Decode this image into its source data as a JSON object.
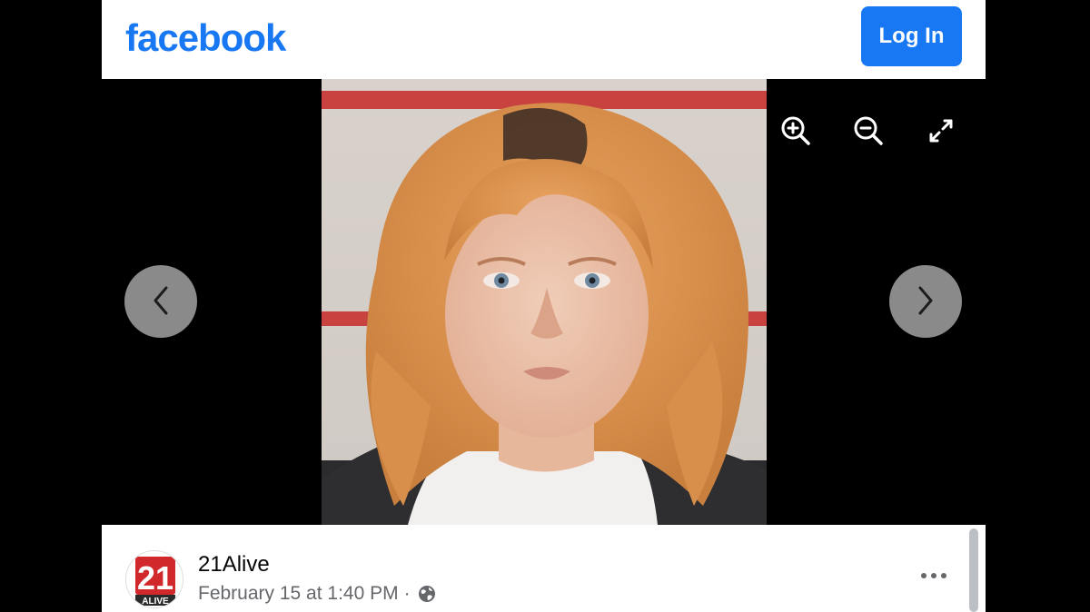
{
  "header": {
    "logo_text": "facebook",
    "login_label": "Log In",
    "brand_color": "#1877f2"
  },
  "viewer": {
    "prev_icon": "chevron-left-icon",
    "next_icon": "chevron-right-icon",
    "tools": [
      "zoom-in-icon",
      "zoom-out-icon",
      "expand-icon"
    ],
    "photo_subject": "portrait-photo"
  },
  "post": {
    "page_name": "21Alive",
    "timestamp": "February 15 at 1:40 PM",
    "separator": "·",
    "privacy_icon": "globe-icon",
    "avatar_logo_number": "21",
    "avatar_logo_word": "ALIVE",
    "more_icon": "more-options-icon"
  }
}
